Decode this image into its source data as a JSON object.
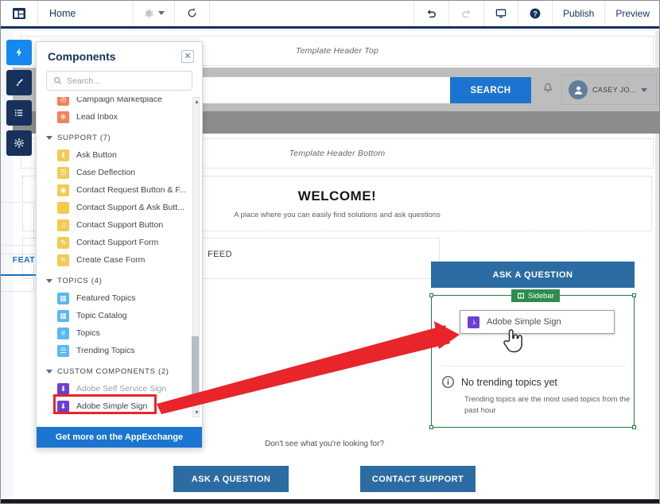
{
  "toolbar": {
    "logo_icon": "builder-logo-icon",
    "home_label": "Home",
    "gear_icon": "gear-icon",
    "refresh_icon": "refresh-icon",
    "undo_icon": "undo-icon",
    "redo_icon": "redo-icon",
    "device_icon": "desktop-icon",
    "help_icon": "help-icon",
    "publish_label": "Publish",
    "preview_label": "Preview"
  },
  "rail": {
    "items": [
      {
        "icon": "lightning-icon",
        "glyph": "⚡",
        "active": true
      },
      {
        "icon": "brush-icon",
        "glyph": "✎",
        "active": false
      },
      {
        "icon": "list-icon",
        "glyph": "☰",
        "active": false
      },
      {
        "icon": "gear-icon",
        "glyph": "⚙",
        "active": false
      }
    ]
  },
  "panel": {
    "title": "Components",
    "close_icon": "close-icon",
    "search_placeholder": "Search...",
    "search_icon": "search-icon",
    "footer_label": "Get more on the AppExchange",
    "partial_items": [
      {
        "label": "Campaign Marketplace",
        "icon": "campaign-marketplace-icon",
        "color": "ico-orange",
        "glyph": "◎"
      },
      {
        "label": "Lead Inbox",
        "icon": "lead-inbox-icon",
        "color": "ico-orange",
        "glyph": "✻"
      }
    ],
    "sections": [
      {
        "name": "SUPPORT (7)",
        "items": [
          {
            "label": "Ask Button",
            "icon": "ask-button-icon",
            "color": "ico-yellow",
            "glyph": "⬇"
          },
          {
            "label": "Case Deflection",
            "icon": "case-deflection-icon",
            "color": "ico-yellow",
            "glyph": "☰"
          },
          {
            "label": "Contact Request Button & F...",
            "icon": "contact-request-icon",
            "color": "ico-yellow",
            "glyph": "◉"
          },
          {
            "label": "Contact Support & Ask Butt...",
            "icon": "contact-support-ask-icon",
            "color": "ico-yellow",
            "glyph": "⚡"
          },
          {
            "label": "Contact Support Button",
            "icon": "contact-support-button-icon",
            "color": "ico-yellow",
            "glyph": "♫"
          },
          {
            "label": "Contact Support Form",
            "icon": "contact-support-form-icon",
            "color": "ico-yellow",
            "glyph": "✎"
          },
          {
            "label": "Create Case Form",
            "icon": "create-case-form-icon",
            "color": "ico-yellow",
            "glyph": "✎"
          }
        ]
      },
      {
        "name": "TOPICS (4)",
        "items": [
          {
            "label": "Featured Topics",
            "icon": "featured-topics-icon",
            "color": "ico-blue",
            "glyph": "▦"
          },
          {
            "label": "Topic Catalog",
            "icon": "topic-catalog-icon",
            "color": "ico-blue",
            "glyph": "▦"
          },
          {
            "label": "Topics",
            "icon": "topics-icon",
            "color": "ico-blue",
            "glyph": "#"
          },
          {
            "label": "Trending Topics",
            "icon": "trending-topics-icon",
            "color": "ico-blue",
            "glyph": "☰"
          }
        ]
      },
      {
        "name": "CUSTOM COMPONENTS (2)",
        "items": [
          {
            "label": "Adobe Self Service Sign",
            "icon": "adobe-pdf-icon",
            "color": "ico-purple",
            "glyph": "⬇",
            "dim": true
          },
          {
            "label": "Adobe Simple Sign",
            "icon": "adobe-pdf-icon",
            "color": "ico-purple",
            "glyph": "⬇",
            "highlighted": true
          }
        ]
      }
    ]
  },
  "canvas": {
    "template_header_top": "Template Header Top",
    "template_header_bottom": "Template Header Bottom",
    "search": {
      "value": "",
      "button_label": "SEARCH",
      "bell_icon": "bell-icon",
      "user_name": "CASEY JO...",
      "avatar_icon": "avatar-icon",
      "caret_icon": "chevron-down-icon"
    },
    "welcome": {
      "heading": "WELCOME!",
      "subtext": "A place where you can easily find solutions and ask questions"
    },
    "featured_tab_label": "FEAT",
    "feed_label": "FEED",
    "sidebar_column": {
      "ask_button_label": "ASK A QUESTION",
      "region_badge": "Sidebar",
      "region_badge_icon": "sidebar-region-icon",
      "dropped_component": {
        "label": "Adobe Simple Sign",
        "icon": "adobe-pdf-icon"
      },
      "no_topics": {
        "info_icon": "info-icon",
        "heading": "No trending topics yet",
        "body": "Trending topics are the most used topics from the past hour"
      }
    },
    "footer": {
      "prompt": "Don't see what you're looking for?",
      "ask_label": "ASK A QUESTION",
      "contact_label": "CONTACT SUPPORT"
    }
  },
  "annotations": {
    "arrow_color": "#e8252a",
    "highlight_box_color": "#e8252a",
    "cursor_icon": "hand-cursor-icon"
  },
  "colors": {
    "brand_navy": "#16325c",
    "brand_blue": "#1b75d0",
    "accent_blue": "#1589ee",
    "steel_blue": "#2b6ca3",
    "region_green": "#2e8b4f",
    "annotation_red": "#e8252a"
  }
}
